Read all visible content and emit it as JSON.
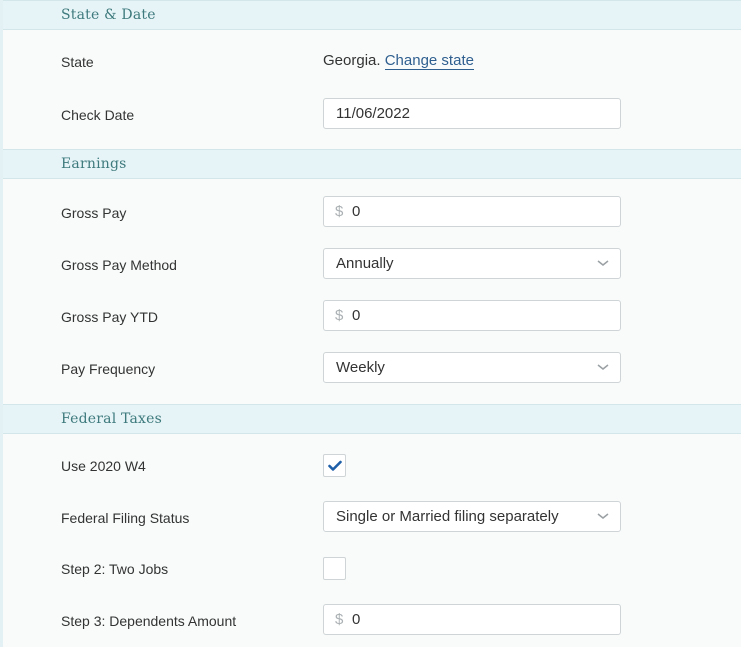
{
  "sections": [
    {
      "title": "State & Date"
    },
    {
      "title": "Earnings"
    },
    {
      "title": "Federal Taxes"
    }
  ],
  "state_date": {
    "state_label": "State",
    "state_value": "Georgia.",
    "change_state_link": "Change state",
    "check_date_label": "Check Date",
    "check_date_value": "11/06/2022"
  },
  "earnings": {
    "gross_pay_label": "Gross Pay",
    "gross_pay_currency": "$",
    "gross_pay_value": "0",
    "gross_pay_method_label": "Gross Pay Method",
    "gross_pay_method_value": "Annually",
    "gross_pay_ytd_label": "Gross Pay YTD",
    "gross_pay_ytd_currency": "$",
    "gross_pay_ytd_value": "0",
    "pay_frequency_label": "Pay Frequency",
    "pay_frequency_value": "Weekly"
  },
  "federal_taxes": {
    "use_2020_w4_label": "Use 2020 W4",
    "use_2020_w4_checked": true,
    "filing_status_label": "Federal Filing Status",
    "filing_status_value": "Single or Married filing separately",
    "two_jobs_label": "Step 2: Two Jobs",
    "two_jobs_checked": false,
    "dependents_label": "Step 3: Dependents Amount",
    "dependents_currency": "$",
    "dependents_value": "0"
  },
  "colors": {
    "section_bg": "#e6f4f7",
    "section_text": "#3e7a7d",
    "link": "#2f5f8f",
    "check": "#1f5fa8"
  }
}
